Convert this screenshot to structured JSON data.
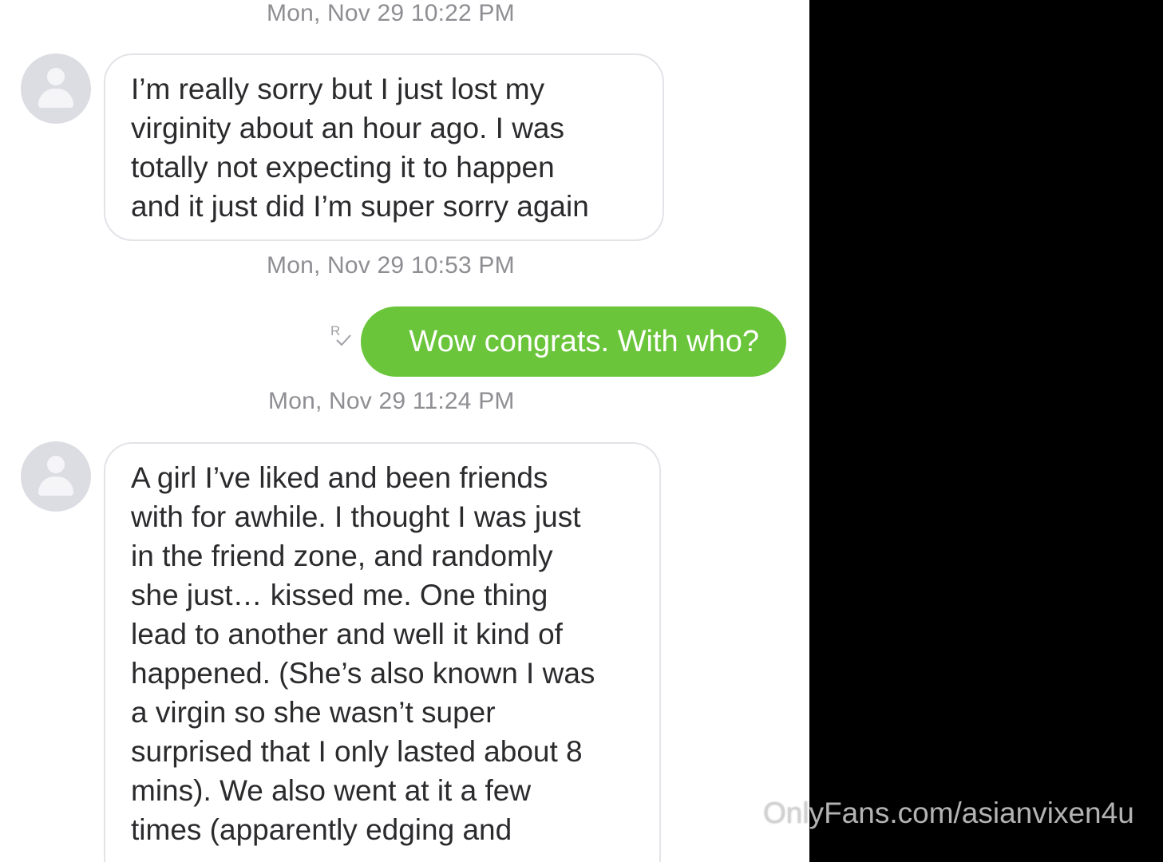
{
  "messages": [
    {
      "timestamp": "Mon, Nov 29 10:22 PM",
      "direction": "incoming",
      "lines": [
        "I’m really sorry but I just lost my",
        "virginity about an hour ago. I was",
        "totally not expecting it to happen",
        "and it just did I’m super sorry again"
      ]
    },
    {
      "timestamp": "Mon, Nov 29 10:53 PM",
      "direction": "outgoing",
      "text": "Wow congrats. With who?",
      "receipt_icon": "read-receipt-icon"
    },
    {
      "timestamp": "Mon, Nov 29 11:24 PM",
      "direction": "incoming",
      "lines": [
        "A girl I’ve liked and been friends",
        "with for awhile. I thought I was just",
        "in the friend zone, and randomly",
        "she just… kissed me. One thing",
        "lead to another and well it kind of",
        "happened. (She’s also known I was",
        "a virgin so she wasn’t super",
        "surprised that I only lasted about 8",
        "mins). We also went at it a few",
        "times (apparently edging and"
      ]
    }
  ],
  "watermark": "OnlyFans.com/asianvixen4u",
  "colors": {
    "outgoing_bubble": "#6ac53b",
    "incoming_border": "#e3e3e8",
    "timestamp": "#8e8e93",
    "background_right": "#000000"
  }
}
